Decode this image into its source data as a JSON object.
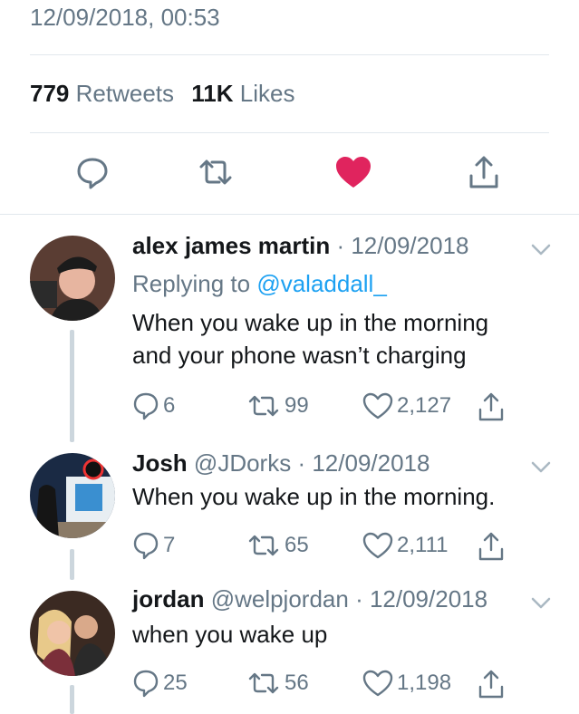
{
  "tweet_meta": {
    "timestamp": "12/09/2018, 00:53",
    "retweet_count": "779",
    "retweet_label": "Retweets",
    "like_count": "11K",
    "like_label": "Likes"
  },
  "main_actions": [
    "reply-icon",
    "retweet-icon",
    "like-icon-filled",
    "share-icon"
  ],
  "colors": {
    "like_red": "#e0245e",
    "link_blue": "#1da1f2",
    "muted_gray": "#657786",
    "divider": "#e1e8ed"
  },
  "replies": [
    {
      "name": "alex james martin",
      "handle": "",
      "date": "· 12/09/2018",
      "replying_prefix": "Replying to",
      "replying_handle": "@valaddall_",
      "text_line1": "When you wake up in the morning",
      "text_line2": "and your phone wasn’t charging",
      "reply_count": "6",
      "retweet_count": "99",
      "like_count": "2,127"
    },
    {
      "name": "Josh",
      "handle": "@JDorks",
      "date": "· 12/09/2018",
      "text_line1": "When you wake up in the morning.",
      "reply_count": "7",
      "retweet_count": "65",
      "like_count": "2,111"
    },
    {
      "name": "jordan",
      "handle": "@welpjordan",
      "date": "· 12/09/2018",
      "text_line1": "when you wake up",
      "reply_count": "25",
      "retweet_count": "56",
      "like_count": "1,198"
    }
  ]
}
